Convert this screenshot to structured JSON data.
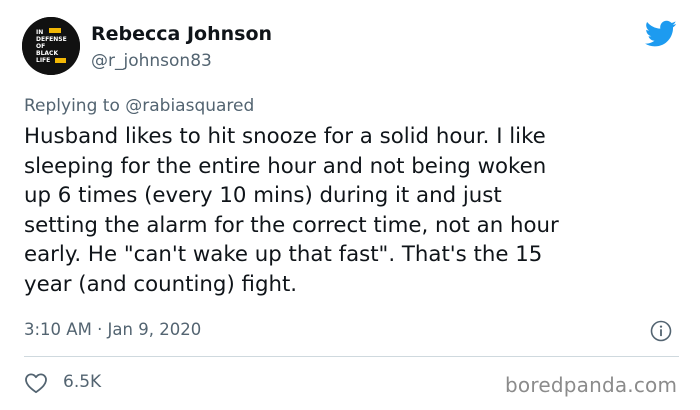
{
  "author": {
    "name": "Rebecca Johnson",
    "handle": "@r_johnson83",
    "avatar_text": [
      "IN",
      "DEFENSE",
      "OF",
      "BLACK",
      "LIFE"
    ]
  },
  "reply": {
    "prefix": "Replying to",
    "mention": "@rabiasquared"
  },
  "tweet": {
    "lines": [
      "Husband likes to hit snooze for a solid hour. I like",
      "sleeping for the entire hour and not being woken",
      "up 6 times (every 10 mins) during it and just",
      "setting the alarm for the correct time, not an hour",
      "early. He \"can't wake up that fast\". That's the 15",
      "year (and counting) fight."
    ],
    "timestamp": "3:10 AM · Jan 9, 2020"
  },
  "stats": {
    "likes": "6.5K"
  },
  "watermark": "boredpanda.com",
  "icons": {
    "brand": "twitter-bird-icon",
    "info": "info-icon",
    "like": "heart-icon"
  },
  "colors": {
    "brand_blue": "#1d9bf0",
    "text_primary": "#0f1419",
    "text_secondary": "#536471",
    "divider": "#cfd9de",
    "avatar_accent": "#f2b705"
  }
}
